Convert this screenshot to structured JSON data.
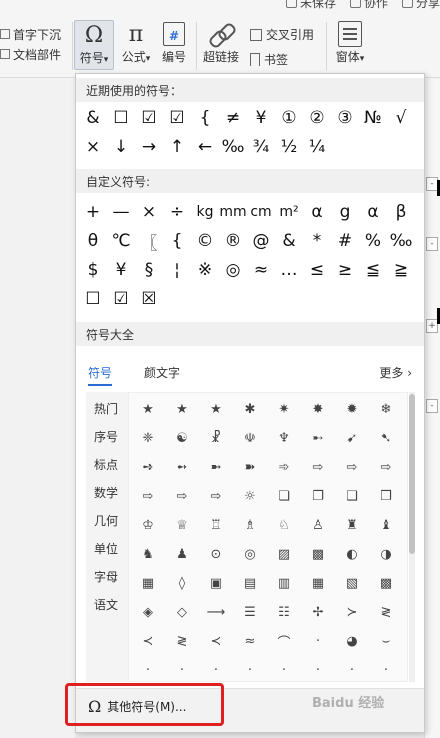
{
  "ribbon": {
    "top_items": [
      "未保存",
      "协作",
      "分享"
    ],
    "left_items": [
      "首字下沉",
      "文档部件"
    ],
    "buttons": [
      {
        "icon": "Ω",
        "label": "符号"
      },
      {
        "icon": "π",
        "label": "公式"
      },
      {
        "icon": "#",
        "label": "编号"
      },
      {
        "label": "超链接"
      },
      {
        "label": "交叉引用"
      },
      {
        "label": "书签"
      },
      {
        "label": "窗体"
      }
    ],
    "dropdown_arrow": "▾"
  },
  "popup": {
    "recent_title": "近期使用的符号：",
    "recent": [
      "&",
      "☐",
      "☑",
      "☑",
      "{",
      "≠",
      "¥",
      "①",
      "②",
      "③",
      "№",
      "√",
      "×",
      "↓",
      "→",
      "↑",
      "←",
      "‰",
      "¾",
      "½",
      "¼"
    ],
    "custom_title": "自定义符号:",
    "custom": [
      "+",
      "—",
      "×",
      "÷",
      "kg",
      "mm",
      "cm",
      "m²",
      "α",
      "g",
      "α",
      "β",
      "θ",
      "℃",
      "〖",
      "{",
      "©",
      "®",
      "@",
      "&",
      "*",
      "#",
      "%",
      "‰",
      "$",
      "¥",
      "§",
      "¦",
      "※",
      "◎",
      "≈",
      "…",
      "≤",
      "≥",
      "≦",
      "≧",
      "☐",
      "☑",
      "☒"
    ],
    "all_title": "符号大全",
    "tabs": [
      "符号",
      "颜文字"
    ],
    "more_label": "更多",
    "categories": [
      "热门",
      "序号",
      "标点",
      "数学",
      "几何",
      "单位",
      "字母",
      "语文"
    ],
    "grid": [
      "★",
      "★",
      "★",
      "✱",
      "✷",
      "✸",
      "✹",
      "❄",
      "❈",
      "☯",
      "☧",
      "☫",
      "♆",
      "➸",
      "➹",
      "➷",
      "➺",
      "➻",
      "➼",
      "➽",
      "➾",
      "⇨",
      "⇨",
      "⇨",
      "⇨",
      "⇨",
      "⇨",
      "☼",
      "❏",
      "❐",
      "❑",
      "❒",
      "♔",
      "♕",
      "♖",
      "♗",
      "♘",
      "♙",
      "♜",
      "♝",
      "♞",
      "♟",
      "⊙",
      "◎",
      "▨",
      "▩",
      "◐",
      "◑",
      "▦",
      "◊",
      "▣",
      "▤",
      "▥",
      "▦",
      "▧",
      "▩",
      "◈",
      "◇",
      "⟶",
      "☰",
      "☷",
      "✢",
      "≻",
      "≷",
      "≺",
      "≷",
      "≺",
      "≈",
      "⌒",
      "·",
      "◕",
      "⌣",
      "·",
      "·",
      "·",
      "·",
      "·",
      "·",
      "·",
      "·"
    ],
    "footer_label": "其他符号(M)...",
    "footer_icon": "Ω"
  },
  "watermark": "Baidu 经验",
  "colors": {
    "accent": "#2a6cd4",
    "highlight": "#e02020"
  }
}
